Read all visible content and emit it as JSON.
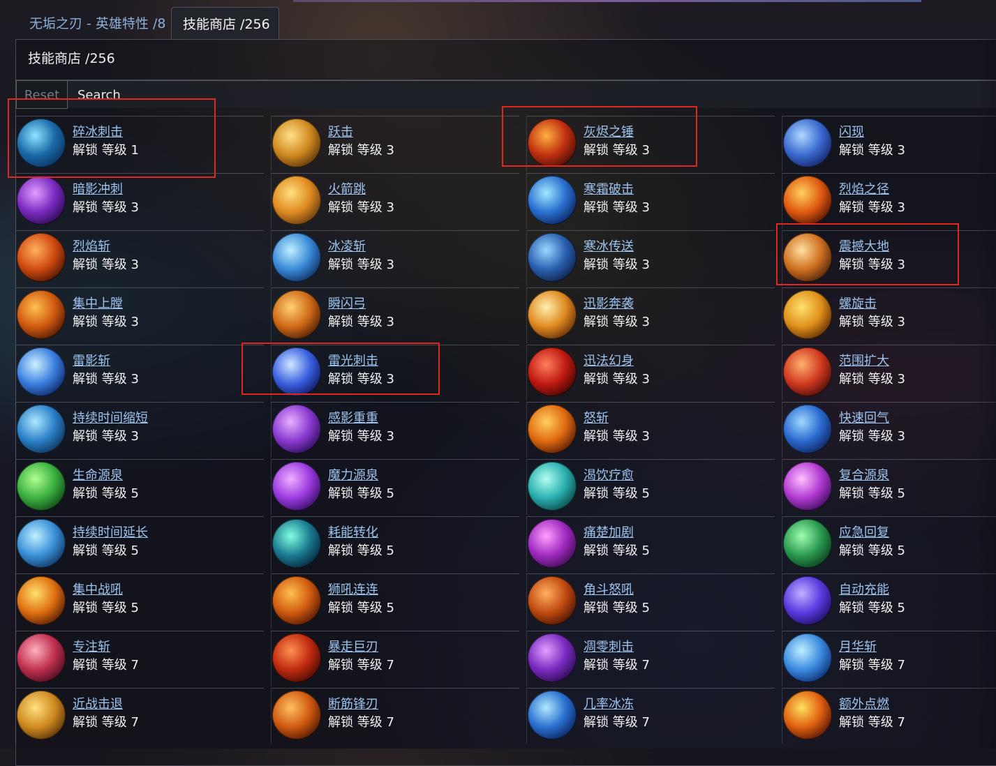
{
  "tabs": [
    {
      "label": "无垢之刃 - 英雄特性 /8",
      "active": false
    },
    {
      "label": "技能商店 /256",
      "active": true
    }
  ],
  "panel": {
    "title": "技能商店 /256"
  },
  "search": {
    "reset_label": "Reset",
    "placeholder": "Search",
    "value": ""
  },
  "colors": {
    "link": "#9cc3ee",
    "highlight": "#e0281e",
    "panel_bg": "#1e2028"
  },
  "skills": [
    {
      "name": "碎冰刺击",
      "unlock": "解锁 等级 1",
      "colors": [
        "#8ce6ff",
        "#1a6aa8",
        "#0a2a55"
      ],
      "highlighted": true
    },
    {
      "name": "跃击",
      "unlock": "解锁 等级 3",
      "colors": [
        "#ffe08a",
        "#d08a20",
        "#4a2808"
      ]
    },
    {
      "name": "灰烬之锤",
      "unlock": "解锁 等级 3",
      "colors": [
        "#ffb040",
        "#c03010",
        "#3a0a05"
      ],
      "highlighted": true
    },
    {
      "name": "闪现",
      "unlock": "解锁 等级 3",
      "colors": [
        "#b0d8ff",
        "#3a6ad0",
        "#101a55"
      ]
    },
    {
      "name": "暗影冲刺",
      "unlock": "解锁 等级 3",
      "colors": [
        "#e0a0ff",
        "#7a2ac0",
        "#200840"
      ]
    },
    {
      "name": "火箭跳",
      "unlock": "解锁 等级 3",
      "colors": [
        "#ffe080",
        "#e08a20",
        "#503010"
      ]
    },
    {
      "name": "寒霜破击",
      "unlock": "解锁 等级 3",
      "colors": [
        "#a0e8ff",
        "#2a70d0",
        "#081a50"
      ]
    },
    {
      "name": "烈焰之径",
      "unlock": "解锁 等级 3",
      "colors": [
        "#ffd060",
        "#e05a10",
        "#400c04"
      ]
    },
    {
      "name": "烈焰斩",
      "unlock": "解锁 等级 3",
      "colors": [
        "#ffb060",
        "#d04a10",
        "#3a0c04"
      ]
    },
    {
      "name": "冰凌斩",
      "unlock": "解锁 等级 3",
      "colors": [
        "#c0f0ff",
        "#3a8ad8",
        "#0a2050"
      ]
    },
    {
      "name": "寒冰传送",
      "unlock": "解锁 等级 3",
      "colors": [
        "#9ad8ff",
        "#2a60b0",
        "#0a1838"
      ]
    },
    {
      "name": "震撼大地",
      "unlock": "解锁 等级 3",
      "colors": [
        "#ffe0a0",
        "#d07020",
        "#3a1a08"
      ],
      "highlighted": true
    },
    {
      "name": "集中上膛",
      "unlock": "解锁 等级 3",
      "colors": [
        "#ffc050",
        "#d05a10",
        "#401004"
      ]
    },
    {
      "name": "瞬闪弓",
      "unlock": "解锁 等级 3",
      "colors": [
        "#ffd070",
        "#d06a18",
        "#3a1404"
      ]
    },
    {
      "name": "迅影奔袭",
      "unlock": "解锁 等级 3",
      "colors": [
        "#fff0b0",
        "#e08a20",
        "#502008"
      ]
    },
    {
      "name": "螺旋击",
      "unlock": "解锁 等级 3",
      "colors": [
        "#ffe070",
        "#e0901a",
        "#4a2004"
      ]
    },
    {
      "name": "雷影斩",
      "unlock": "解锁 等级 3",
      "colors": [
        "#d0f0ff",
        "#3a80e0",
        "#0a1a55"
      ]
    },
    {
      "name": "雷光刺击",
      "unlock": "解锁 等级 3",
      "colors": [
        "#d0e8ff",
        "#3a60e0",
        "#0a1050"
      ],
      "highlighted": true
    },
    {
      "name": "迅法幻身",
      "unlock": "解锁 等级 3",
      "colors": [
        "#ff8060",
        "#c01a10",
        "#300404"
      ]
    },
    {
      "name": "范围扩大",
      "unlock": "解锁 等级 3",
      "colors": [
        "#ffb070",
        "#d03a20",
        "#3a0808"
      ]
    },
    {
      "name": "持续时间缩短",
      "unlock": "解锁 等级 3",
      "colors": [
        "#b0e8ff",
        "#2a80c8",
        "#0a2848"
      ]
    },
    {
      "name": "感影重重",
      "unlock": "解锁 等级 3",
      "colors": [
        "#e8b0ff",
        "#8a3ad0",
        "#200848"
      ]
    },
    {
      "name": "怒斩",
      "unlock": "解锁 等级 3",
      "colors": [
        "#ffd060",
        "#e06a10",
        "#401004"
      ]
    },
    {
      "name": "快速回气",
      "unlock": "解锁 等级 3",
      "colors": [
        "#a0d8ff",
        "#2a6ad0",
        "#0a1a48"
      ]
    },
    {
      "name": "生命源泉",
      "unlock": "解锁 等级 5",
      "colors": [
        "#b0ff90",
        "#3ab040",
        "#0a3a10"
      ]
    },
    {
      "name": "魔力源泉",
      "unlock": "解锁 等级 5",
      "colors": [
        "#f0b0ff",
        "#9a3ae0",
        "#2a0850"
      ]
    },
    {
      "name": "渴饮疗愈",
      "unlock": "解锁 等级 5",
      "colors": [
        "#b0fff0",
        "#2ab0b0",
        "#083838"
      ]
    },
    {
      "name": "复合源泉",
      "unlock": "解锁 等级 5",
      "colors": [
        "#ffc0ff",
        "#b03ad0",
        "#300850"
      ]
    },
    {
      "name": "持续时间延长",
      "unlock": "解锁 等级 5",
      "colors": [
        "#c0f0ff",
        "#3a90d8",
        "#0a2850"
      ]
    },
    {
      "name": "耗能转化",
      "unlock": "解锁 等级 5",
      "colors": [
        "#80ffe0",
        "#1a7a90",
        "#061a30"
      ]
    },
    {
      "name": "痛楚加剧",
      "unlock": "解锁 等级 5",
      "colors": [
        "#ffa0ff",
        "#a02ac0",
        "#300840"
      ]
    },
    {
      "name": "应急回复",
      "unlock": "解锁 等级 5",
      "colors": [
        "#a0ffb0",
        "#2a9a50",
        "#083018"
      ]
    },
    {
      "name": "集中战吼",
      "unlock": "解锁 等级 5",
      "colors": [
        "#ffe070",
        "#e07010",
        "#401004"
      ]
    },
    {
      "name": "狮吼连连",
      "unlock": "解锁 等级 5",
      "colors": [
        "#ffc050",
        "#d05a10",
        "#401004"
      ]
    },
    {
      "name": "角斗怒吼",
      "unlock": "解锁 等级 5",
      "colors": [
        "#ffb060",
        "#c04a10",
        "#3a0c04"
      ]
    },
    {
      "name": "自动充能",
      "unlock": "解锁 等级 5",
      "colors": [
        "#c0b0ff",
        "#5a3ae0",
        "#180a50"
      ]
    },
    {
      "name": "专注斩",
      "unlock": "解锁 等级 7",
      "colors": [
        "#ffb0c0",
        "#c03050",
        "#3a0818"
      ]
    },
    {
      "name": "暴走巨刃",
      "unlock": "解锁 等级 7",
      "colors": [
        "#ff9050",
        "#c02a10",
        "#380604"
      ]
    },
    {
      "name": "凋零刺击",
      "unlock": "解锁 等级 7",
      "colors": [
        "#e0a0ff",
        "#7a2ac0",
        "#200840"
      ]
    },
    {
      "name": "月华斩",
      "unlock": "解锁 等级 7",
      "colors": [
        "#c0f0ff",
        "#3a8ae0",
        "#0a2060"
      ]
    },
    {
      "name": "近战击退",
      "unlock": "解锁 等级 7",
      "colors": [
        "#ffe080",
        "#d08a20",
        "#4a2808"
      ]
    },
    {
      "name": "断筋锋刃",
      "unlock": "解锁 等级 7",
      "colors": [
        "#ffc060",
        "#d05a10",
        "#401004"
      ]
    },
    {
      "name": "几率冰冻",
      "unlock": "解锁 等级 7",
      "colors": [
        "#b0e8ff",
        "#2a70d0",
        "#081a50"
      ]
    },
    {
      "name": "额外点燃",
      "unlock": "解锁 等级 7",
      "colors": [
        "#ffe060",
        "#e06010",
        "#400c04"
      ]
    }
  ]
}
